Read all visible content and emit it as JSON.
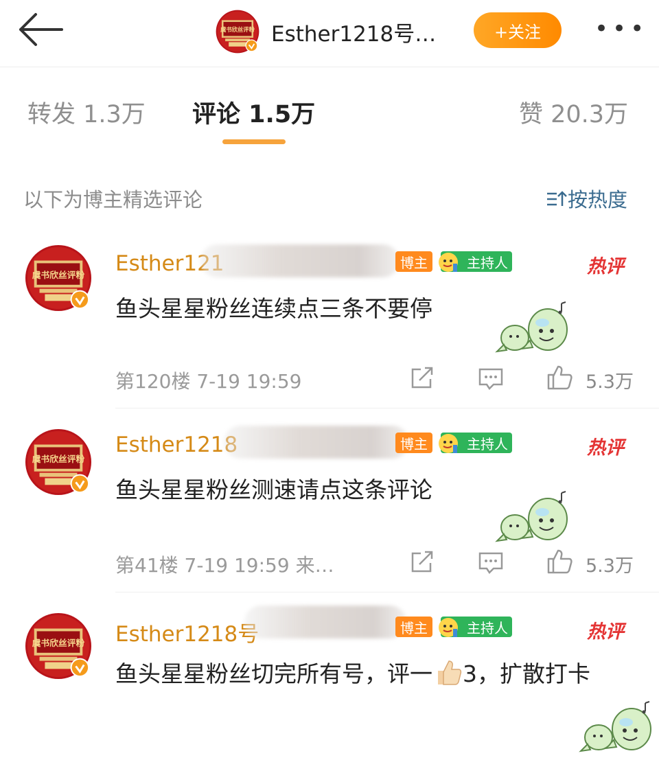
{
  "header": {
    "back_icon": "back-arrow-icon",
    "name": "Esther1218号…",
    "follow_label": "+关注",
    "more_label": "•••"
  },
  "tabs": [
    {
      "label": "转发 1.3万"
    },
    {
      "label": "评论 1.5万"
    },
    {
      "label": "赞 20.3万"
    }
  ],
  "section": {
    "hint": "以下为博主精选评论",
    "sort_label": "按热度"
  },
  "comments": [
    {
      "name": "Esther121",
      "badge_owner": "博主",
      "badge_host": "主持人",
      "hot": "热评",
      "text": "鱼头星星粉丝连续点三条不要停",
      "meta": "第120楼 7-19 19:59",
      "likes": "5.3万"
    },
    {
      "name": "Esther1218",
      "badge_owner": "博主",
      "badge_host": "主持人",
      "hot": "热评",
      "text": "鱼头星星粉丝测速请点这条评论",
      "meta": "第41楼 7-19 19:59 来…",
      "likes": "5.3万"
    },
    {
      "name": "Esther1218号",
      "badge_owner": "博主",
      "badge_host": "主持人",
      "hot": "热评",
      "text_part1": "鱼头星星粉丝切完所有号，评一",
      "text_part2": "3，扩散打卡"
    }
  ],
  "colors": {
    "accent_orange": "#f6a33c",
    "name_orange": "#d58a17",
    "hot_red": "#e43434",
    "host_green": "#2fb45a"
  }
}
